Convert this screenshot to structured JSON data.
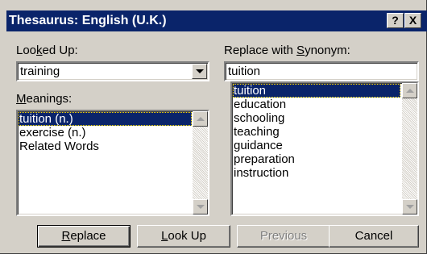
{
  "window": {
    "title": "Thesaurus: English (U.K.)",
    "help_button": "?",
    "close_button": "X"
  },
  "looked_up": {
    "label_pre": "Loo",
    "label_key": "k",
    "label_post": "ed Up:",
    "value": "training"
  },
  "replace_with": {
    "label_pre": "Replace with ",
    "label_key": "S",
    "label_post": "ynonym:",
    "value": "tuition"
  },
  "meanings": {
    "label_pre": "",
    "label_key": "M",
    "label_post": "eanings:",
    "items": [
      "tuition (n.)",
      "exercise (n.)",
      "Related Words"
    ],
    "selected_index": 0
  },
  "synonyms": {
    "items": [
      "tuition",
      "education",
      "schooling",
      "teaching",
      "guidance",
      "preparation",
      "instruction"
    ],
    "selected_index": 0
  },
  "buttons": {
    "replace": {
      "key": "R",
      "rest": "eplace"
    },
    "look_up": {
      "key": "L",
      "rest": "ook Up"
    },
    "previous": {
      "label": "Previous"
    },
    "cancel": {
      "label": "Cancel"
    }
  },
  "icons": {
    "dropdown": "chevron-down-icon",
    "scroll_up": "scroll-up-arrow-icon",
    "scroll_down": "scroll-down-arrow-icon"
  },
  "colors": {
    "titlebar": "#0a246a",
    "selection": "#0a246a",
    "dialog_face": "#d4d0c8"
  }
}
